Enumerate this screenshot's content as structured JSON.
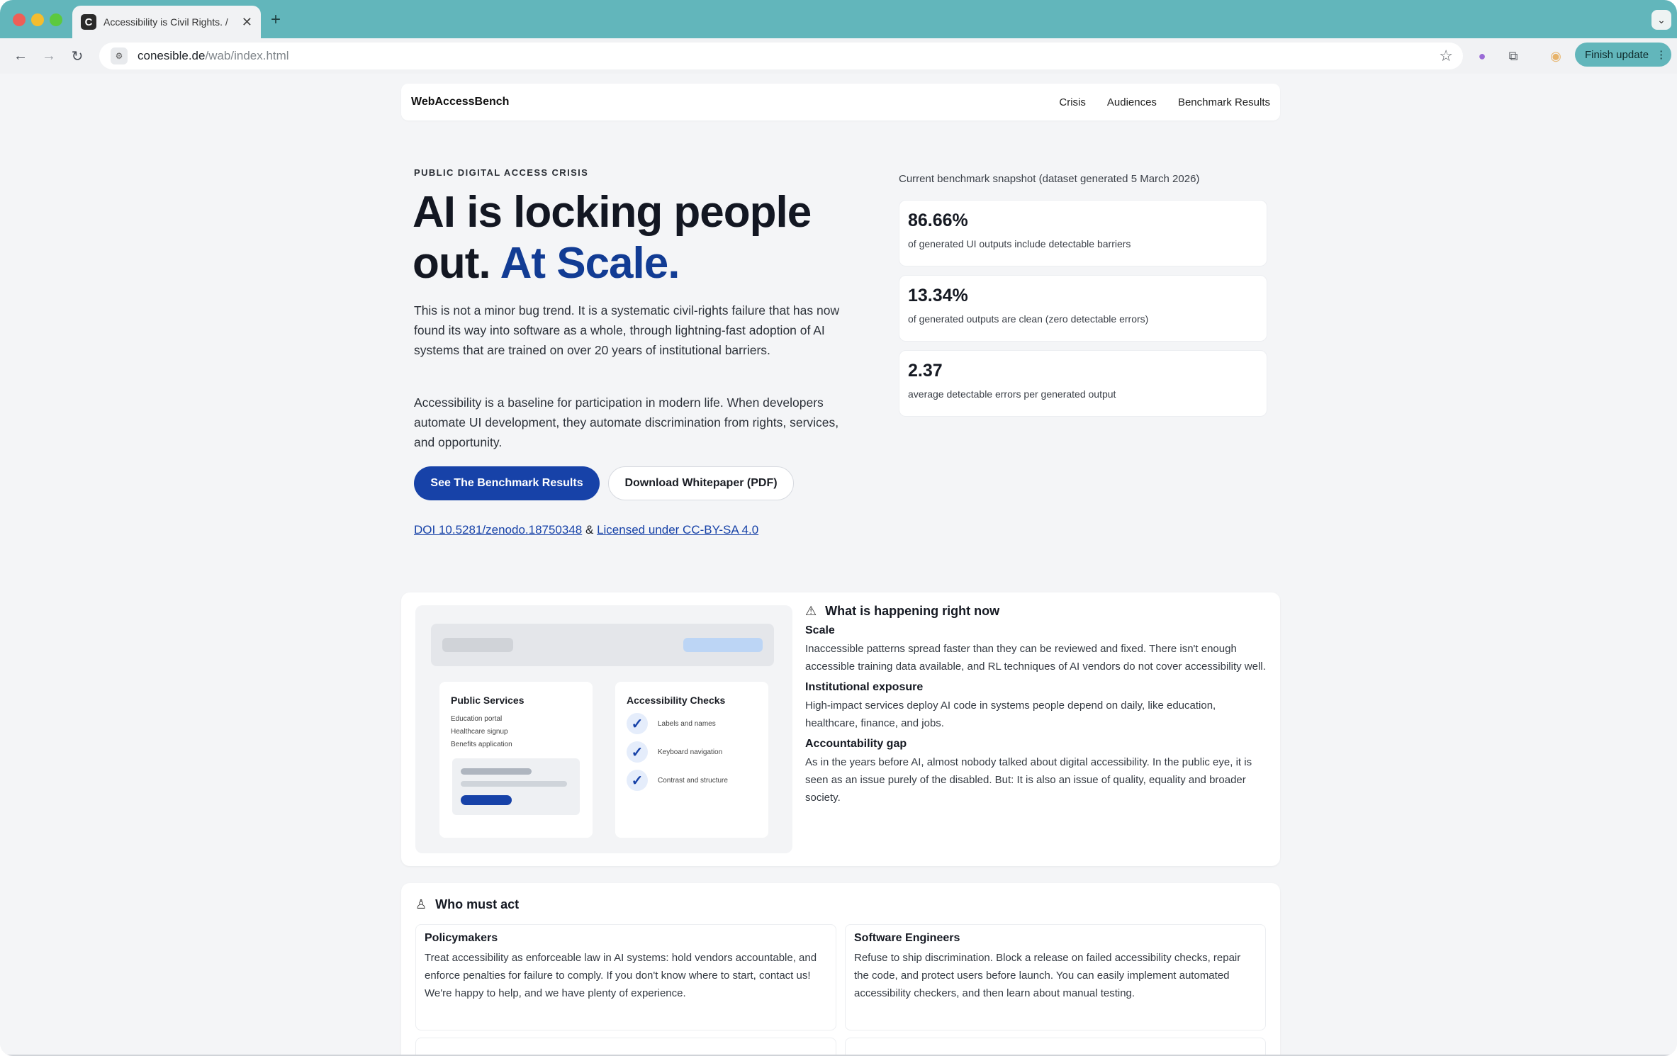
{
  "browser": {
    "tab_title": "Accessibility is Civil Rights. /",
    "tab_favicon": "C",
    "tab_close": "✕",
    "new_tab": "+",
    "url_host": "conesible.de",
    "url_path": "/wab/index.html",
    "finish_update": "Finish update",
    "icons": [
      "back-arrow-icon",
      "forward-arrow-icon",
      "reload-icon",
      "site-settings-icon",
      "bookmark-star-icon",
      "extension-puzzle-icon",
      "profile-avatar-icon",
      "tab-search-chevron-icon"
    ]
  },
  "nav": {
    "brand": "WebAccessBench",
    "links": [
      "Crisis",
      "Audiences",
      "Benchmark Results"
    ]
  },
  "hero": {
    "kicker": "PUBLIC DIGITAL ACCESS CRISIS",
    "title_line1": "AI is locking people",
    "title_line2_plain": "out.",
    "title_line2_accent": "At Scale.",
    "p1": "This is not a minor bug trend. It is a systematic civil-rights failure that has now found its way into software as a whole, through lightning-fast adoption of AI systems that are trained on over 20 years of institutional barriers.",
    "p2": "Accessibility is a baseline for participation in modern life. When developers automate UI development, they automate discrimination from rights, services, and opportunity.",
    "primary_button": "See The Benchmark Results",
    "secondary_button": "Download Whitepaper (PDF)",
    "doi_link": "DOI 10.5281/zenodo.18750348",
    "amp": "&",
    "license_link": "Licensed under CC-BY-SA 4.0"
  },
  "snapshot": {
    "label": "Current benchmark snapshot (dataset generated 5 March 2026)",
    "stats": [
      {
        "value": "86.66%",
        "label": "of generated UI outputs include detectable barriers"
      },
      {
        "value": "13.34%",
        "label": "of generated outputs are clean (zero detectable errors)"
      },
      {
        "value": "2.37",
        "label": "average detectable errors per generated output"
      }
    ]
  },
  "illustration": {
    "card_a_title": "Public Services",
    "card_a_items": [
      "Education portal",
      "Healthcare signup",
      "Benefits application"
    ],
    "card_b_title": "Accessibility Checks",
    "card_b_items": [
      "Labels and names",
      "Keyboard navigation",
      "Contrast and structure"
    ]
  },
  "happening": {
    "title": "What is happening right now",
    "items": [
      {
        "heading": "Scale",
        "text": "Inaccessible patterns spread faster than they can be reviewed and fixed. There isn't enough accessible training data available, and RL techniques of AI vendors do not cover accessibility well."
      },
      {
        "heading": "Institutional exposure",
        "text": "High-impact services deploy AI code in systems people depend on daily, like education, healthcare, finance, and jobs."
      },
      {
        "heading": "Accountability gap",
        "text": "As in the years before AI, almost nobody talked about digital accessibility. In the public eye, it is seen as an issue purely of the disabled. But: It is also an issue of quality, equality and broader society."
      }
    ]
  },
  "act": {
    "title": "Who must act",
    "roles": [
      {
        "heading": "Policymakers",
        "text": "Treat accessibility as enforceable law in AI systems: hold vendors accountable, and enforce penalties for failure to comply. If you don't know where to start, contact us! We're happy to help, and we have plenty of experience."
      },
      {
        "heading": "Software Engineers",
        "text": "Refuse to ship discrimination. Block a release on failed accessibility checks, repair the code, and protect users before launch. You can easily implement automated accessibility checkers, and then learn about manual testing."
      }
    ]
  }
}
